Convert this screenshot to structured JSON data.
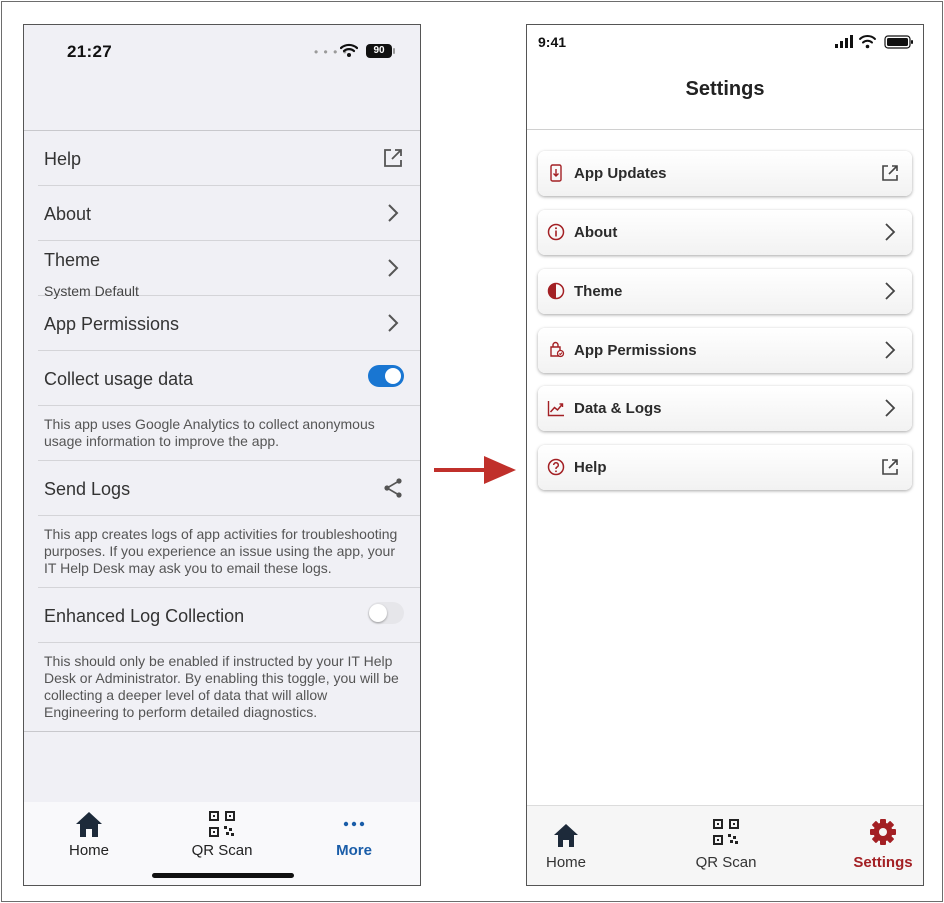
{
  "left_screen": {
    "status": {
      "time": "21:27",
      "battery": "90"
    },
    "rows": [
      {
        "label": "Help",
        "trail": "external-link-icon"
      },
      {
        "label": "About",
        "trail": "chevron-right-icon"
      },
      {
        "label": "Theme",
        "sublabel": "System Default",
        "trail": "chevron-right-icon"
      },
      {
        "label": "App Permissions",
        "trail": "chevron-right-icon"
      },
      {
        "label": "Collect usage data",
        "toggle": true,
        "description": "This app uses Google Analytics to collect anonymous usage information to improve the app."
      },
      {
        "label": "Send Logs",
        "trail": "share-icon",
        "description": "This app creates logs of app activities for troubleshooting purposes. If you experience an issue using the app, your IT Help Desk may ask you to email these logs."
      },
      {
        "label": "Enhanced Log Collection",
        "toggle": false,
        "description": "This should only be enabled if instructed by your IT Help Desk or Administrator. By enabling this toggle, you will be collecting a deeper level of data that will allow Engineering to perform detailed diagnostics."
      }
    ],
    "tabs": [
      {
        "label": "Home",
        "icon": "home-icon"
      },
      {
        "label": "QR Scan",
        "icon": "qr-code-icon"
      },
      {
        "label": "More",
        "icon": "more-dots-icon",
        "active": true
      }
    ],
    "colors": {
      "toggle_on": "#1976d2",
      "active_tab": "#1a5da8",
      "background": "#f0f0f5"
    }
  },
  "right_screen": {
    "status": {
      "time": "9:41"
    },
    "title": "Settings",
    "cards": [
      {
        "label": "App Updates",
        "icon": "download-phone-icon",
        "trail": "external-link-icon"
      },
      {
        "label": "About",
        "icon": "info-icon",
        "trail": "chevron-right-icon"
      },
      {
        "label": "Theme",
        "icon": "half-circle-icon",
        "trail": "chevron-right-icon"
      },
      {
        "label": "App Permissions",
        "icon": "permissions-icon",
        "trail": "chevron-right-icon"
      },
      {
        "label": "Data & Logs",
        "icon": "chart-line-icon",
        "trail": "chevron-right-icon"
      },
      {
        "label": "Help",
        "icon": "help-circle-icon",
        "trail": "external-link-icon"
      }
    ],
    "tabs": [
      {
        "label": "Home",
        "icon": "home-icon"
      },
      {
        "label": "QR Scan",
        "icon": "qr-code-icon"
      },
      {
        "label": "Settings",
        "icon": "gear-icon",
        "active": true
      }
    ],
    "colors": {
      "accent": "#a32024"
    }
  },
  "transition_arrow": {
    "icon": "arrow-right-icon",
    "color": "#c0302b"
  }
}
